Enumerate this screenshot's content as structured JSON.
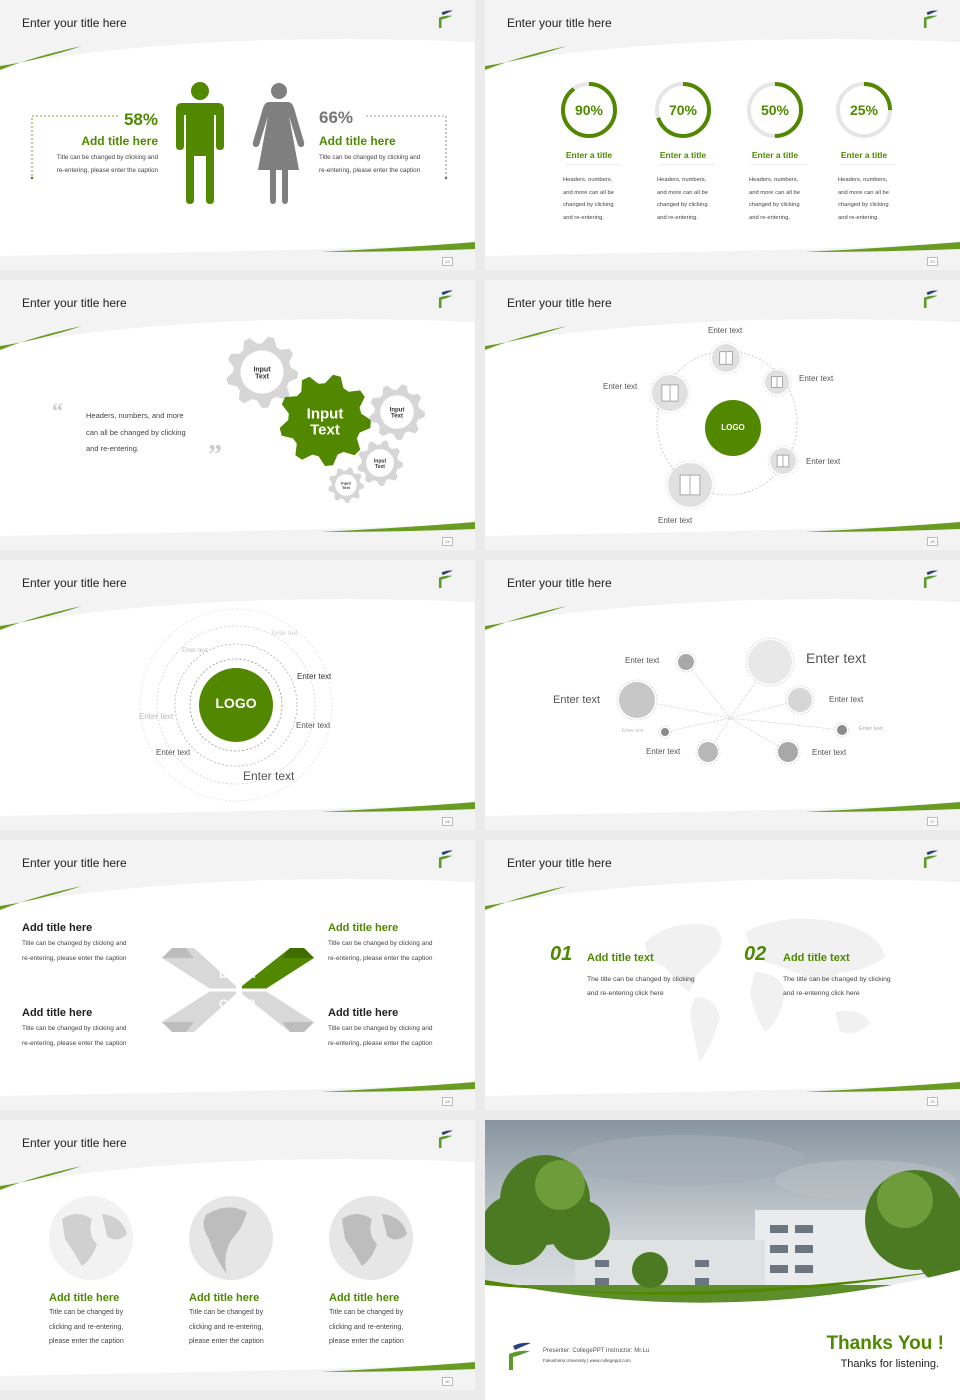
{
  "colors": {
    "accent": "#528800",
    "gray": "#d4d4d4",
    "dark_gray": "#7f7f7f"
  },
  "slides": [
    {
      "title": "Enter your title here",
      "page": "22",
      "left": {
        "percent": "58%",
        "heading": "Add title here",
        "caption": [
          "Title can be changed by clicking and",
          "re-entering, please enter the caption"
        ]
      },
      "right": {
        "percent": "66%",
        "heading": "Add title here",
        "caption": [
          "Title can be changed by clicking and",
          "re-entering, please enter the caption"
        ]
      },
      "icons": [
        "male-icon",
        "female-icon"
      ]
    },
    {
      "title": "Enter your title here",
      "page": "23",
      "items": [
        {
          "percent": "90%",
          "value": 90,
          "heading": "Enter a title",
          "text": [
            "Headers, numbers,",
            "and more can all be",
            "changed by clicking",
            "and re-entering."
          ]
        },
        {
          "percent": "70%",
          "value": 70,
          "heading": "Enter a title",
          "text": [
            "Headers, numbers,",
            "and more can all be",
            "changed by clicking",
            "and re-entering."
          ]
        },
        {
          "percent": "50%",
          "value": 50,
          "heading": "Enter a title",
          "text": [
            "Headers, numbers,",
            "and more can all be",
            "changed by clicking",
            "and re-entering."
          ]
        },
        {
          "percent": "25%",
          "value": 25,
          "heading": "Enter a title",
          "text": [
            "Headers, numbers,",
            "and more can all be",
            "changed by clicking",
            "and re-entering."
          ]
        }
      ]
    },
    {
      "title": "Enter your title here",
      "page": "24",
      "quote": [
        "Headers, numbers, and more",
        "can all be changed by clicking",
        "and re-entering."
      ],
      "gears": [
        "Input Text",
        "Input Text",
        "Input Text",
        "Input Text",
        "Input Text"
      ]
    },
    {
      "title": "Enter your title here",
      "page": "25",
      "logo": "LOGO",
      "labels": [
        "Enter text",
        "Enter text",
        "Enter text",
        "Enter text",
        "Enter text"
      ]
    },
    {
      "title": "Enter your title here",
      "page": "26",
      "logo": "LOGO",
      "labels": [
        "Enter text",
        "Enter text",
        "Enter text",
        "Enter text",
        "Enter text",
        "Enter text",
        "Enter text"
      ]
    },
    {
      "title": "Enter your title here",
      "page": "27",
      "labels": [
        "Enter text",
        "Enter text",
        "Enter text",
        "Enter text",
        "Enter text",
        "Enter text",
        "Enter text",
        "Enter text"
      ]
    },
    {
      "title": "Enter your title here",
      "page": "28",
      "letters": [
        "A",
        "B",
        "C",
        "D"
      ],
      "blocks": [
        {
          "heading": "Add title here",
          "caption": [
            "Title can be changed by clicking and",
            "re-entering, please enter the caption"
          ]
        },
        {
          "heading": "Add title here",
          "caption": [
            "Title can be changed by clicking and",
            "re-entering, please enter the caption"
          ]
        },
        {
          "heading": "Add title here",
          "caption": [
            "Title can be changed by clicking and",
            "re-entering, please enter the caption"
          ]
        },
        {
          "heading": "Add title here",
          "caption": [
            "Title can be changed by clicking and",
            "re-entering, please enter the caption"
          ]
        }
      ]
    },
    {
      "title": "Enter your title here",
      "page": "29",
      "items": [
        {
          "num": "01",
          "heading": "Add title text",
          "text": [
            "The title can be changed by clicking",
            "and re-entering click here"
          ]
        },
        {
          "num": "02",
          "heading": "Add title text",
          "text": [
            "The title can be changed by clicking",
            "and re-entering click here"
          ]
        }
      ]
    },
    {
      "title": "Enter your title here",
      "page": "30",
      "items": [
        {
          "heading": "Add title here",
          "text": [
            "Title can be changed by",
            "clicking and re-entering,",
            "please enter the caption"
          ]
        },
        {
          "heading": "Add title here",
          "text": [
            "Title can be changed by",
            "clicking and re-entering,",
            "please enter the caption"
          ]
        },
        {
          "heading": "Add title here",
          "text": [
            "Title can be changed by",
            "clicking and re-entering,",
            "please enter the caption"
          ]
        }
      ]
    },
    {
      "presenter": "Presenter: CollegePPT   Instructor: Mr.Lu",
      "university": "Fukushima University  |  www.collegeppt.com",
      "thanks": "Thanks You !",
      "subtitle": "Thanks for listening."
    }
  ]
}
